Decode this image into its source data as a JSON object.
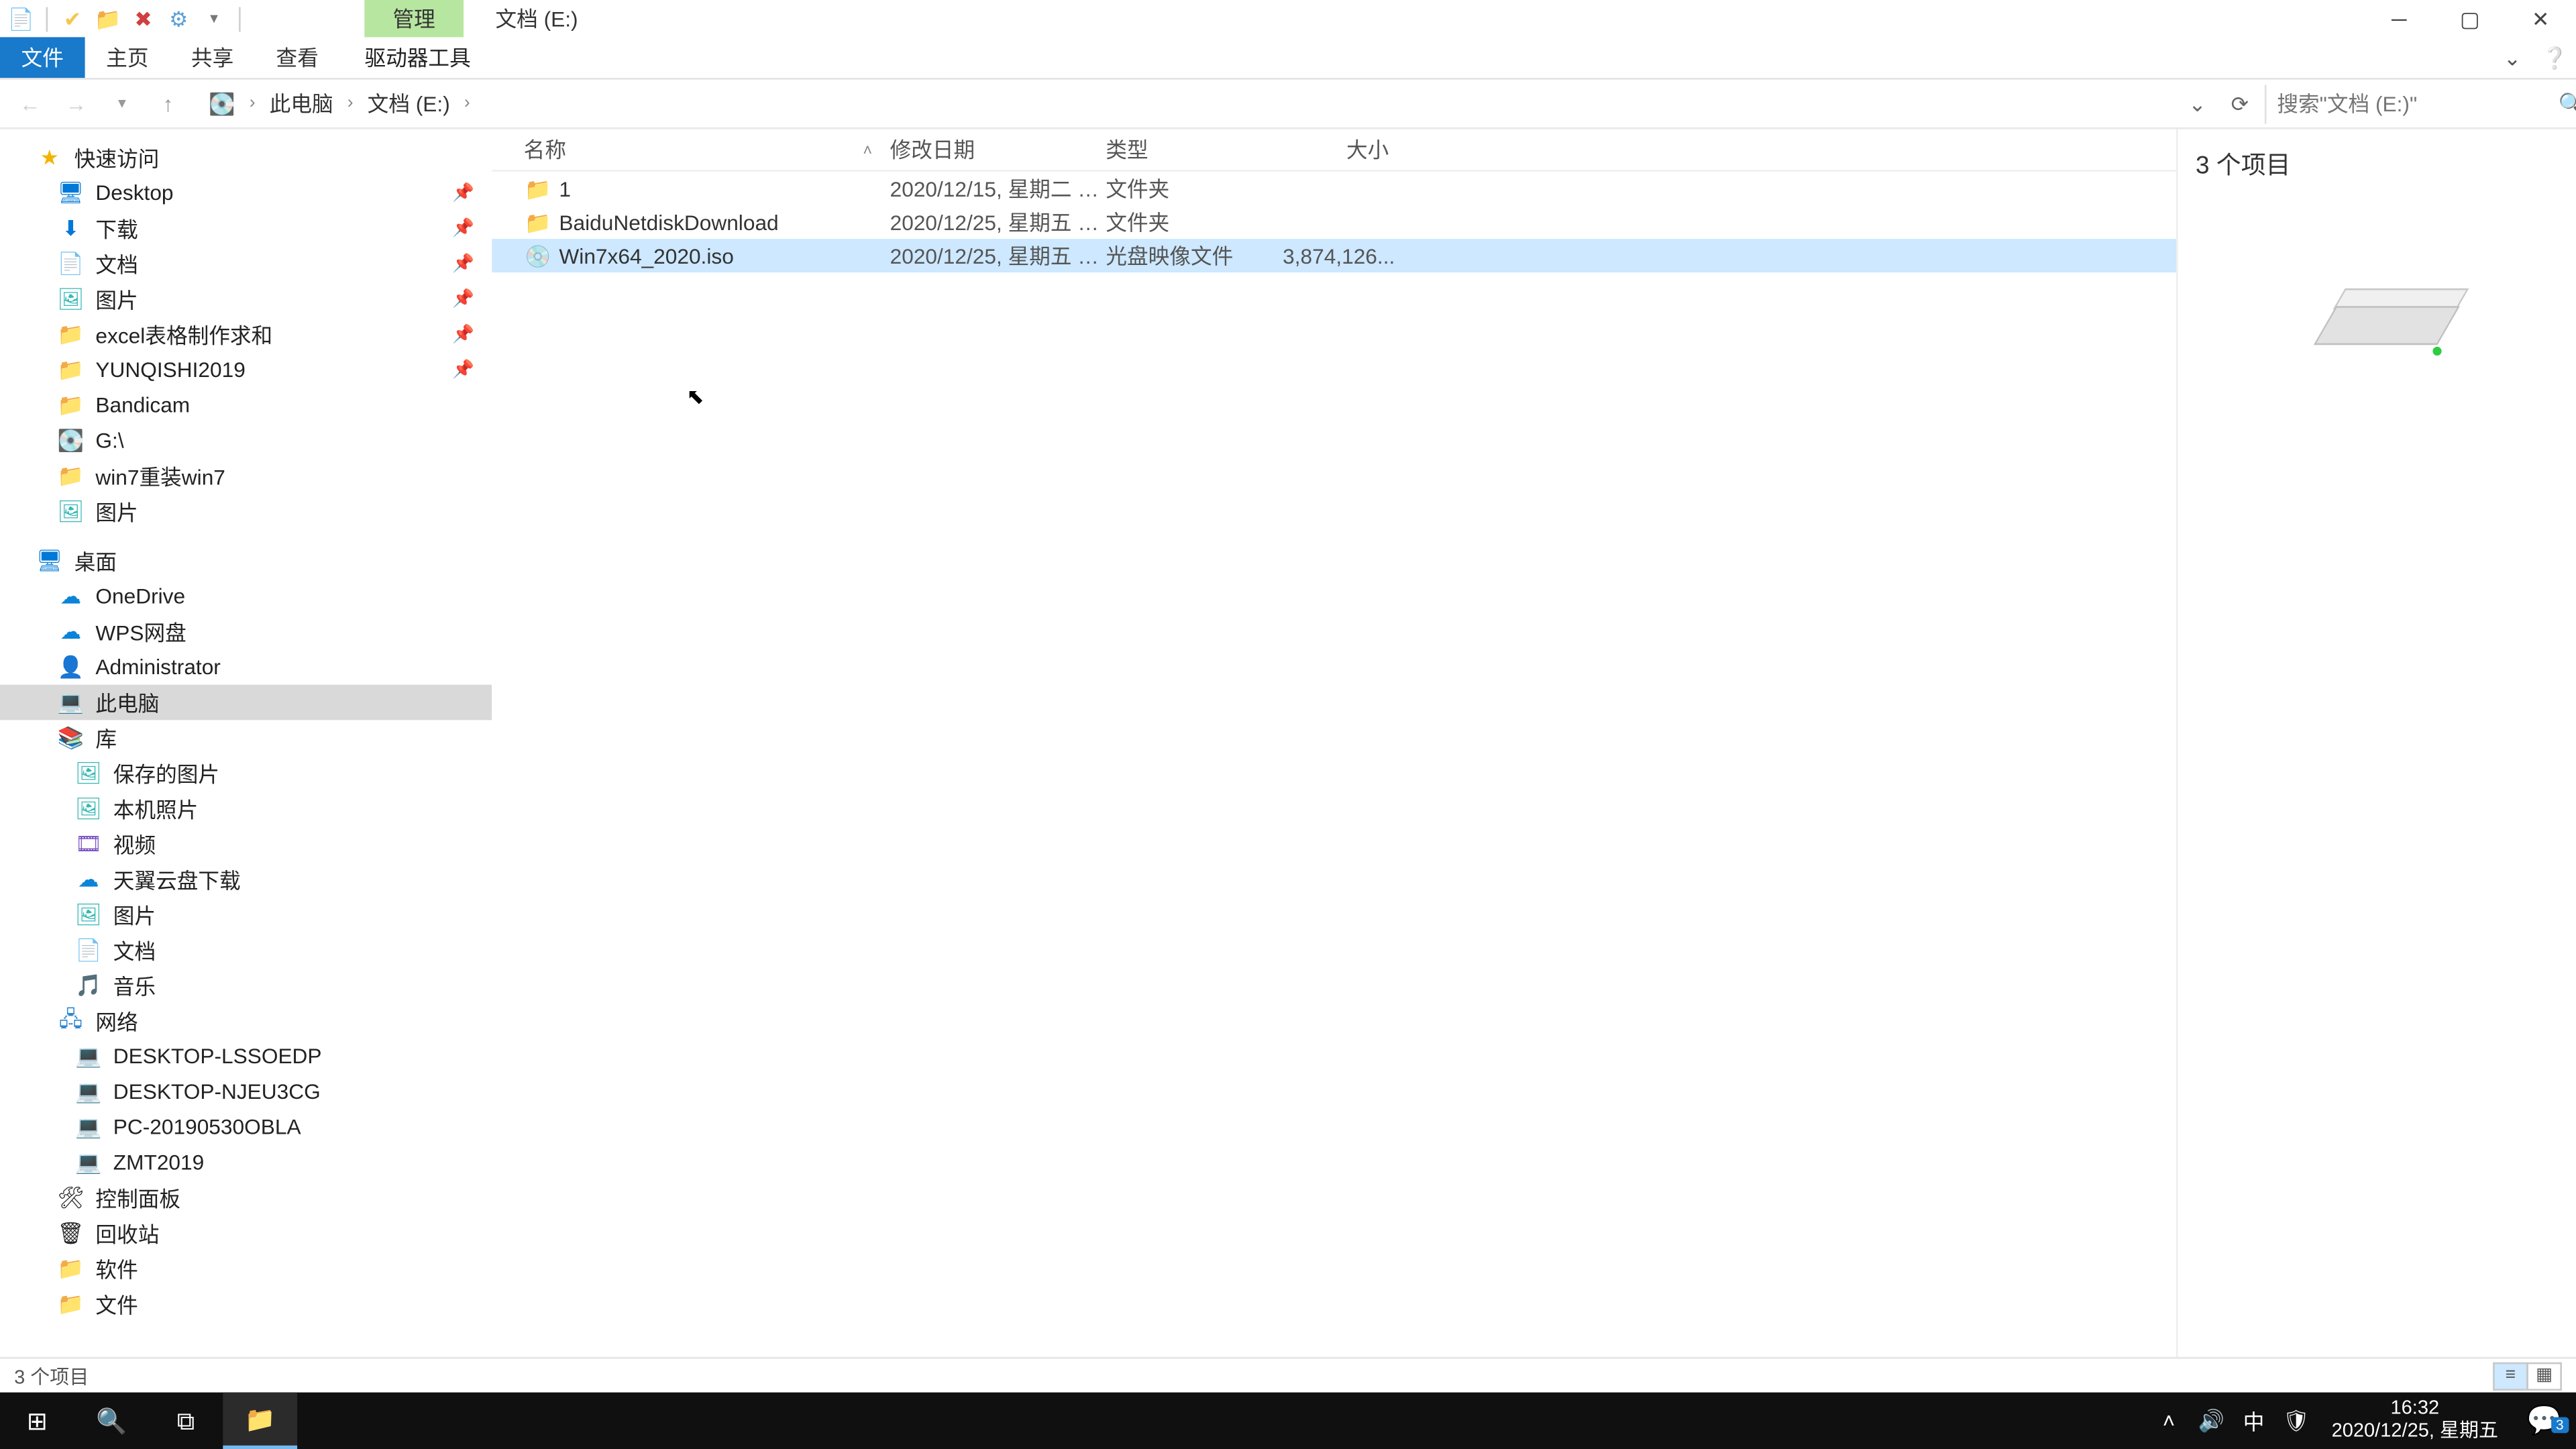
{
  "qat": {
    "manage_tab": "管理",
    "path_tab": "文档 (E:)"
  },
  "ribbon": {
    "file": "文件",
    "home": "主页",
    "share": "共享",
    "view": "查看",
    "drive_tools": "驱动器工具"
  },
  "breadcrumb": {
    "pc": "此电脑",
    "drive": "文档 (E:)"
  },
  "search": {
    "placeholder": "搜索\"文档 (E:)\""
  },
  "tree": {
    "quick_access": "快速访问",
    "desktop": "Desktop",
    "downloads": "下载",
    "documents": "文档",
    "pictures": "图片",
    "excel_req": "excel表格制作求和",
    "yunqishi": "YUNQISHI2019",
    "bandicam": "Bandicam",
    "gdrive": "G:\\",
    "win7reinstall": "win7重装win7",
    "pictures2": "图片",
    "desktop_cn": "桌面",
    "onedrive": "OneDrive",
    "wps": "WPS网盘",
    "admin": "Administrator",
    "this_pc": "此电脑",
    "library": "库",
    "saved_pics": "保存的图片",
    "camera_roll": "本机照片",
    "videos": "视频",
    "tianyi": "天翼云盘下载",
    "lib_pics": "图片",
    "lib_docs": "文档",
    "music": "音乐",
    "network": "网络",
    "d1": "DESKTOP-LSSOEDP",
    "d2": "DESKTOP-NJEU3CG",
    "d3": "PC-20190530OBLA",
    "d4": "ZMT2019",
    "control_panel": "控制面板",
    "recycle": "回收站",
    "software": "软件",
    "files": "文件"
  },
  "columns": {
    "name": "名称",
    "date": "修改日期",
    "type": "类型",
    "size": "大小"
  },
  "rows": [
    {
      "icon": "folder",
      "name": "1",
      "date": "2020/12/15, 星期二 1...",
      "type": "文件夹",
      "size": ""
    },
    {
      "icon": "folder",
      "name": "BaiduNetdiskDownload",
      "date": "2020/12/25, 星期五 1...",
      "type": "文件夹",
      "size": ""
    },
    {
      "icon": "iso",
      "name": "Win7x64_2020.iso",
      "date": "2020/12/25, 星期五 1...",
      "type": "光盘映像文件",
      "size": "3,874,126..."
    }
  ],
  "info": {
    "count_label": "3 个项目"
  },
  "status": {
    "items": "3 个项目"
  },
  "taskbar": {
    "ime": "中",
    "time": "16:32",
    "date": "2020/12/25, 星期五",
    "notif_count": "3"
  }
}
